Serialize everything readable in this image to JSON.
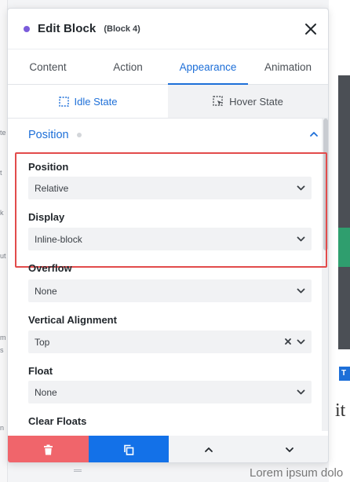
{
  "header": {
    "title": "Edit Block",
    "subtitle": "(Block 4)"
  },
  "tabs": [
    {
      "label": "Content",
      "active": false
    },
    {
      "label": "Action",
      "active": false
    },
    {
      "label": "Appearance",
      "active": true
    },
    {
      "label": "Animation",
      "active": false
    }
  ],
  "states": {
    "idle": "Idle State",
    "hover": "Hover State"
  },
  "section": {
    "title": "Position"
  },
  "fields": {
    "position": {
      "label": "Position",
      "value": "Relative"
    },
    "display": {
      "label": "Display",
      "value": "Inline-block"
    },
    "overflow": {
      "label": "Overflow",
      "value": "None"
    },
    "vertical_alignment": {
      "label": "Vertical Alignment",
      "value": "Top"
    },
    "float": {
      "label": "Float",
      "value": "None"
    },
    "clear_floats": {
      "label": "Clear Floats"
    }
  },
  "background": {
    "lorem": "Lorem ipsum dolo",
    "badge": "T",
    "edge_text": "it",
    "left_fragments": [
      "te",
      "t",
      "k",
      "ut",
      "m",
      "s",
      "n"
    ]
  },
  "colors": {
    "accent": "#1d6fd8",
    "highlight": "#e24b4b",
    "delete": "#f0656b",
    "copy": "#1371e8",
    "dot": "#7b5cdb"
  },
  "icons": {
    "close": "close-icon",
    "idle_state": "dashed-square-icon",
    "hover_state": "dashed-square-cursor-icon",
    "delete": "trash-icon",
    "copy": "copy-icon",
    "up": "chevron-up-icon",
    "down": "chevron-down-icon"
  }
}
